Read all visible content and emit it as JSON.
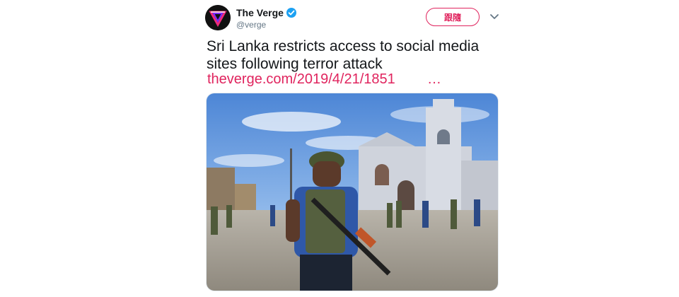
{
  "tweet": {
    "author": {
      "display_name": "The Verge",
      "handle": "@verge",
      "verified": true,
      "avatar_icon": "verge-logo-icon"
    },
    "follow_label": "跟隨",
    "text": "Sri Lanka restricts access to social media sites following terror attack",
    "link_text": "theverge.com/2019/4/21/1851",
    "link_ellipsis": "…",
    "media": {
      "description": "photo"
    }
  },
  "colors": {
    "accent": "#e0245e",
    "verified_blue": "#1da1f2",
    "text_primary": "#14171a",
    "text_secondary": "#657786"
  }
}
